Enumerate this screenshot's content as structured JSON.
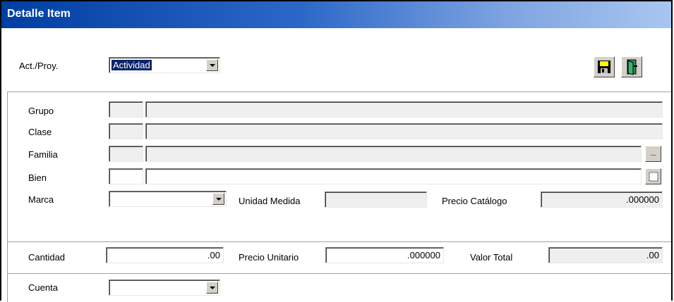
{
  "window": {
    "title": "Detalle Item"
  },
  "header": {
    "act_label": "Act./Proy.",
    "act_value": "Actividad",
    "save_icon": "floppy-disk-icon",
    "exit_icon": "door-exit-icon"
  },
  "fields": {
    "grupo_label": "Grupo",
    "clase_label": "Clase",
    "familia_label": "Familia",
    "bien_label": "Bien",
    "familia_lookup": "...",
    "bien_lookup_icon": "lookup-box-icon",
    "marca_label": "Marca",
    "marca_value": "",
    "unidad_label": "Unidad Medida",
    "unidad_value": "",
    "precio_catalogo_label": "Precio Catálogo",
    "precio_catalogo_value": ".000000"
  },
  "totals": {
    "cantidad_label": "Cantidad",
    "cantidad_value": ".00",
    "precio_unitario_label": "Precio Unitario",
    "precio_unitario_value": ".000000",
    "valor_total_label": "Valor Total",
    "valor_total_value": ".00"
  },
  "cuenta": {
    "label": "Cuenta",
    "value": ""
  },
  "colors": {
    "title_gradient_start": "#003ea1",
    "title_gradient_end": "#a9c6f1",
    "selection": "#0a246a",
    "button_face": "#d4d0c8"
  }
}
